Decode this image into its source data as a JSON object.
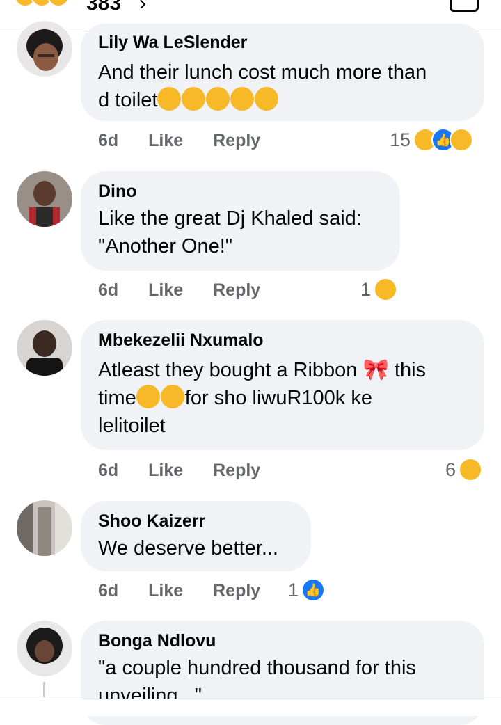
{
  "header": {
    "reaction_count": "383"
  },
  "comments": [
    {
      "author": "Lily Wa LeSlender",
      "text": "And their lunch cost much more than\nd toilet",
      "time": "6d",
      "like": "Like",
      "reply": "Reply",
      "reaction_count": "15",
      "reaction_icons": [
        "haha-icon",
        "like-icon",
        "sad-icon"
      ]
    },
    {
      "author": "Dino",
      "text": "Like the great Dj Khaled said:\n\"Another One!\"",
      "time": "6d",
      "like": "Like",
      "reply": "Reply",
      "reaction_count": "1",
      "reaction_icons": [
        "haha-icon"
      ]
    },
    {
      "author": "Mbekezelii Nxumalo",
      "text_a": "Atleast they bought a Ribbon ",
      "text_b": " this",
      "text_c": "time",
      "text_d": "for sho liwuR100k ke\nlelitoilet",
      "time": "6d",
      "like": "Like",
      "reply": "Reply",
      "reaction_count": "6",
      "reaction_icons": [
        "haha-icon"
      ]
    },
    {
      "author": "Shoo Kaizerr",
      "text": "We deserve better...",
      "time": "6d",
      "like": "Like",
      "reply": "Reply",
      "reaction_count": "1",
      "reaction_icons": [
        "like-icon"
      ]
    },
    {
      "author": "Bonga Ndlovu",
      "text": "\"a couple hundred thousand for this\nunveiling...\""
    }
  ],
  "colors": {
    "bubble": "#f0f2f5",
    "meta": "#65676b",
    "like_blue": "#1877f2",
    "emoji_yellow": "#f7b928"
  }
}
